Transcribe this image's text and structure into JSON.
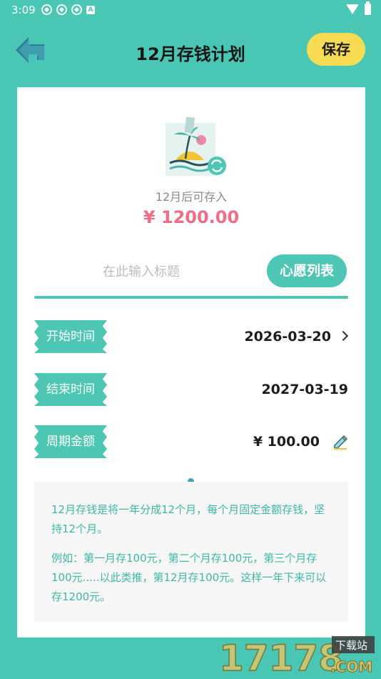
{
  "status_bar": {
    "time": "3:09",
    "badge": "A"
  },
  "header": {
    "title": "12月存钱计划",
    "save_label": "保存"
  },
  "wish": {
    "caption": "12月后可存入",
    "amount": "¥ 1200.00"
  },
  "title_input": {
    "placeholder": "在此输入标题",
    "value": ""
  },
  "wishlist_button": "心愿列表",
  "rows": [
    {
      "label": "开始时间",
      "value": "2026-03-20"
    },
    {
      "label": "结束时间",
      "value": "2027-03-19"
    },
    {
      "label": "周期金额",
      "value": "¥ 100.00"
    }
  ],
  "info": {
    "paragraph1": "12月存钱是将一年分成12个月，每个月固定金额存钱，坚持12个月。",
    "paragraph2": "例如：第一月存100元，第二个月存100元，第三个月存100元.....以此类推，第12月存100元。这样一年下来可以存1200元。"
  },
  "watermark": {
    "text": "17178",
    "sub": "下载站",
    "suffix": ".COM"
  },
  "colors": {
    "background": "#49c7b4",
    "accent": "#4dc6b4",
    "save": "#f7dc53",
    "amount": "#ef6e86"
  }
}
